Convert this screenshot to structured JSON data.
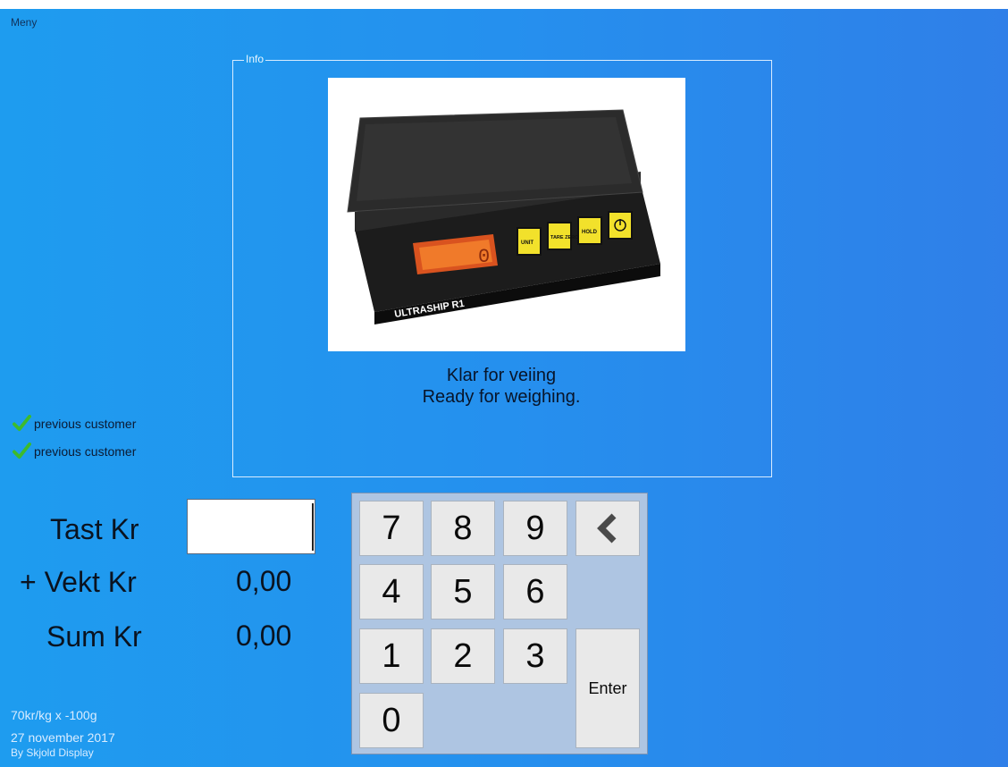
{
  "menu": {
    "label": "Meny"
  },
  "info": {
    "legend": "Info",
    "status_line1": "Klar for veiing",
    "status_line2": "Ready for weighing.",
    "image_brand_text": "ULTRASHIP R1",
    "image_buttons": [
      "UNIT",
      "TARE ZERO",
      "HOLD"
    ]
  },
  "previous": [
    {
      "label": "previous customer"
    },
    {
      "label": "previous customer"
    }
  ],
  "fields": {
    "tast_label": "Tast Kr",
    "tast_value": "",
    "vekt_label": "+ Vekt Kr",
    "vekt_value": "0,00",
    "sum_label": "Sum Kr",
    "sum_value": "0,00"
  },
  "footer": {
    "rate": "70kr/kg  x   -100g",
    "date": "27 november 2017",
    "credit": "By Skjold Display"
  },
  "keypad": {
    "keys": [
      "7",
      "8",
      "9",
      "4",
      "5",
      "6",
      "1",
      "2",
      "3",
      "0"
    ],
    "enter_label": "Enter",
    "backspace_icon": "chevron-left-icon"
  },
  "colors": {
    "background_start": "#1e9cef",
    "background_end": "#2f7fe8",
    "keypad_bg": "#aec5e2",
    "key_bg": "#e9e9e9",
    "check_green": "#3dbb2c"
  }
}
